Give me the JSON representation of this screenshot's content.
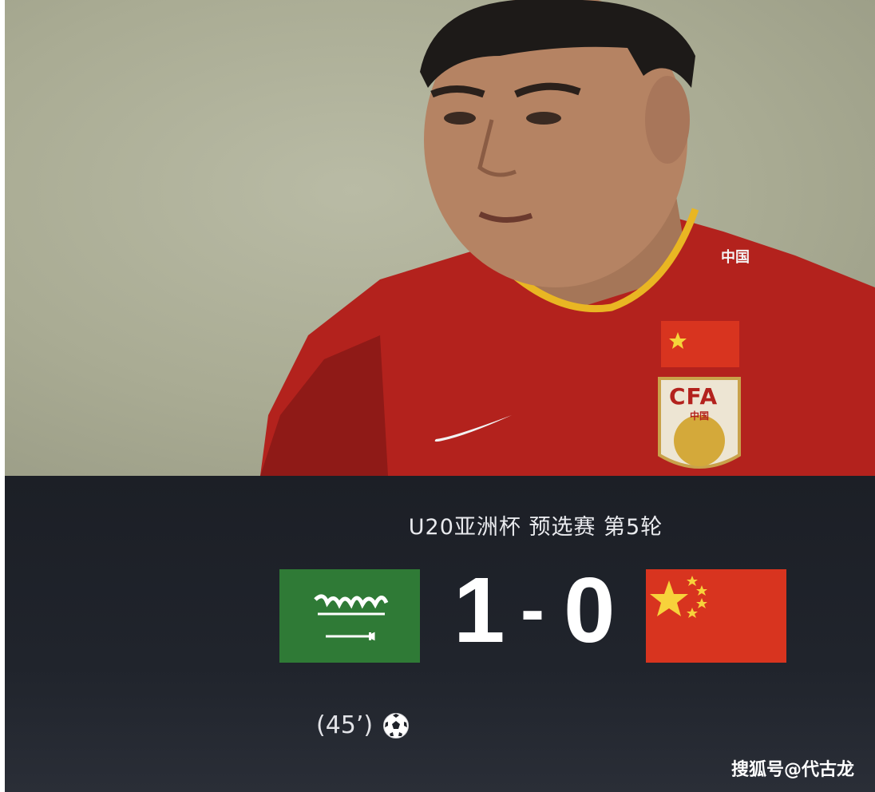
{
  "photo": {
    "jersey_text": "中国",
    "crest_text": "CFA",
    "crest_subtext": "中国",
    "icon": "player-photo"
  },
  "match": {
    "competition": "U20亚洲杯 预选赛 第5轮",
    "home_team_flag": "saudi-arabia-flag",
    "away_team_flag": "china-flag",
    "home_score": "1",
    "separator": "-",
    "away_score": "0",
    "goal_event": {
      "minute": "(45’)",
      "icon": "soccer-ball-icon"
    }
  },
  "watermark": "搜狐号@代古龙",
  "colors": {
    "board_bg": "#1c1f26",
    "saudi_green": "#2f7a36",
    "china_red": "#d8341f",
    "jersey_red": "#b3221d",
    "jersey_trim": "#e9b623"
  }
}
